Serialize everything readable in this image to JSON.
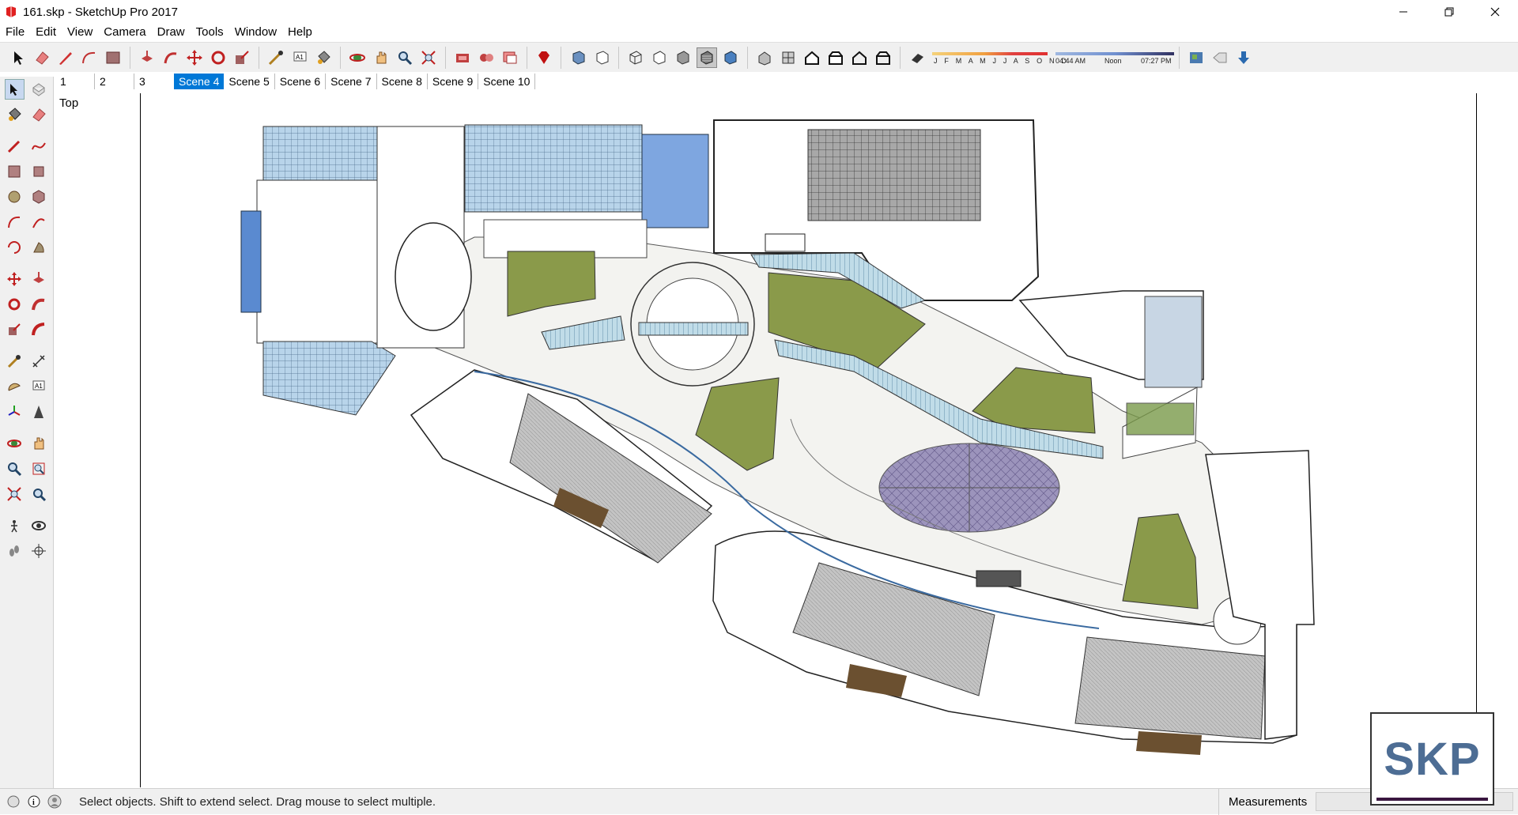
{
  "window": {
    "title": "161.skp - SketchUp Pro 2017",
    "controls": [
      "minimize",
      "restore",
      "close"
    ]
  },
  "menu": [
    "File",
    "Edit",
    "View",
    "Camera",
    "Draw",
    "Tools",
    "Window",
    "Help"
  ],
  "toolbar": {
    "icons": [
      "select-icon",
      "eraser-icon",
      "pencil-icon",
      "arc-icon",
      "rectangle-icon",
      "push-pull-icon",
      "follow-me-icon",
      "move-icon",
      "rotate-icon",
      "scale-icon",
      "tape-measure-icon",
      "text-icon",
      "paint-bucket-icon",
      "orbit-icon",
      "pan-icon",
      "zoom-icon",
      "zoom-extents-icon",
      "warehouse-icon",
      "extension-warehouse-icon",
      "layout-icon",
      "ruby-icon",
      "xray-icon",
      "back-edges-icon",
      "wireframe-icon",
      "hidden-line-icon",
      "shaded-icon",
      "shaded-textures-icon",
      "monochrome-icon",
      "iso-view-icon",
      "top-view-icon",
      "front-view-icon",
      "right-view-icon",
      "back-view-icon",
      "left-view-icon",
      "shadows-icon"
    ],
    "shadow_months": "J F M A M J J A S O N D",
    "shadow_time_start": "04:44 AM",
    "shadow_time_mid": "Noon",
    "shadow_time_end": "07:27 PM"
  },
  "scenes": {
    "tabs": [
      "1",
      "2",
      "3",
      "Scene 4",
      "Scene 5",
      "Scene 6",
      "Scene 7",
      "Scene 8",
      "Scene 9",
      "Scene 10"
    ],
    "active": "Scene 4"
  },
  "left_toolbar": {
    "icons": [
      "select-icon",
      "component-icon",
      "paint-bucket-icon",
      "eraser-icon",
      "line-icon",
      "freehand-icon",
      "rectangle-icon",
      "rotated-rectangle-icon",
      "circle-icon",
      "polygon-icon",
      "arc-icon",
      "two-point-arc-icon",
      "three-point-arc-icon",
      "pie-icon",
      "move-icon",
      "push-pull-icon",
      "rotate-icon",
      "follow-me-icon",
      "scale-icon",
      "offset-icon",
      "tape-measure-icon",
      "dimension-icon",
      "protractor-icon",
      "text-icon",
      "axes-icon",
      "3d-text-icon",
      "orbit-icon",
      "pan-icon",
      "zoom-icon",
      "zoom-window-icon",
      "zoom-extents-icon",
      "previous-view-icon",
      "position-camera-icon",
      "look-around-icon",
      "walk-icon",
      "section-plane-icon"
    ]
  },
  "viewport": {
    "view_name": "Top",
    "colors": {
      "grass": "#8a9a4a",
      "roof_grey": "#bcbcbc",
      "glass_blue": "#a8c8e0",
      "dome": "#9890b8",
      "brown": "#6b5030"
    }
  },
  "status": {
    "message": "Select objects. Shift to extend select. Drag mouse to select multiple.",
    "measurements_label": "Measurements",
    "measurements_value": ""
  },
  "logo": {
    "text": "SKP"
  }
}
